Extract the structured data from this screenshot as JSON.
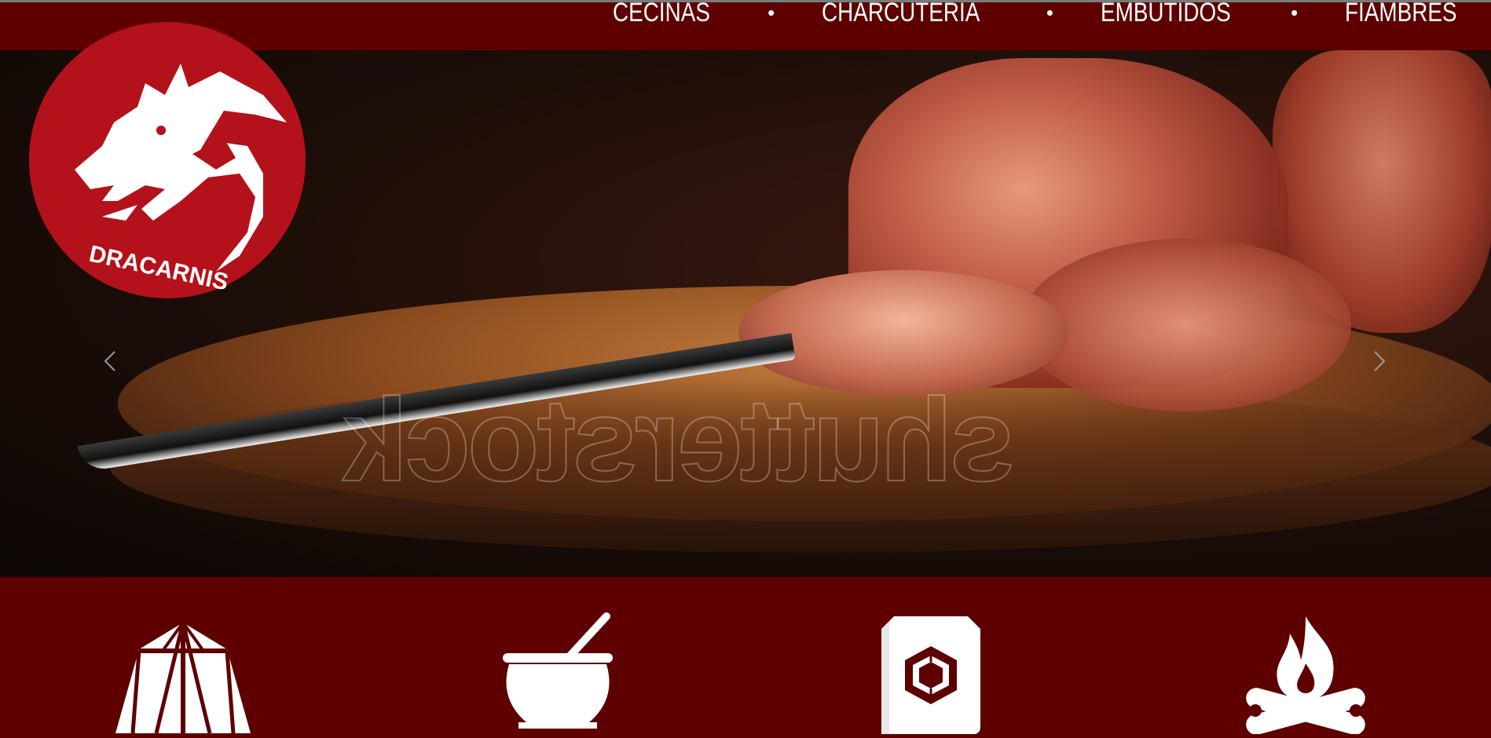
{
  "nav": {
    "items": [
      "CECINAS",
      "CHARCUTERIA",
      "EMBUTIDOS",
      "FIAMBRES"
    ],
    "separator": "•"
  },
  "brand": {
    "name": "DRACARNIS"
  },
  "hero": {
    "watermark": "shutterstock",
    "prev_icon": "chevron-left-icon",
    "next_icon": "chevron-right-icon"
  },
  "features": {
    "icons": [
      "tent-icon",
      "cauldron-icon",
      "gem-book-icon",
      "campfire-icon"
    ]
  },
  "colors": {
    "brand_dark_red": "#5e0000",
    "logo_red": "#b3121a",
    "white": "#ffffff"
  }
}
